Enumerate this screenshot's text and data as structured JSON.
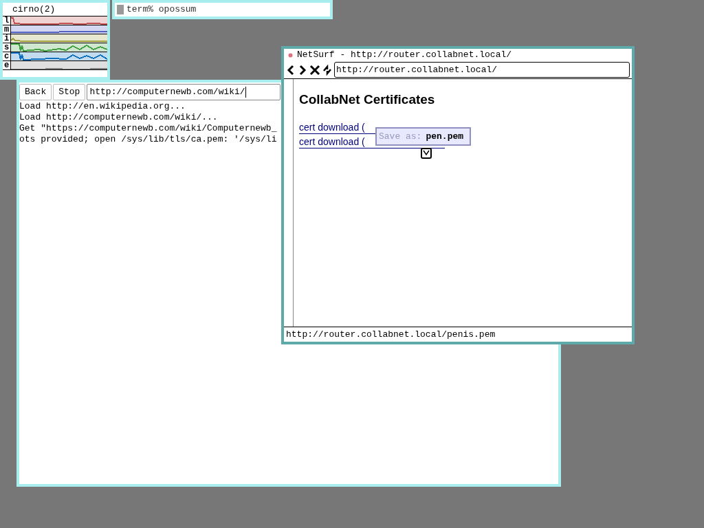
{
  "stats": {
    "title": "cirno(2)",
    "graphs": [
      {
        "label": "l",
        "color": "#c05050"
      },
      {
        "label": "m",
        "color": "#5060c0"
      },
      {
        "label": "i",
        "color": "#a0a040"
      },
      {
        "label": "s",
        "color": "#40a040"
      },
      {
        "label": "c",
        "color": "#1070c0"
      },
      {
        "label": "e",
        "color": "#808080"
      }
    ]
  },
  "terminal": {
    "line": "term% opossum"
  },
  "browser": {
    "buttons": [
      "Back",
      "Stop"
    ],
    "url": "http://computernewb.com/wiki/",
    "log": [
      "Load http://en.wikipedia.org...",
      "Load http://computernewb.com/wiki/...",
      "Get \"https://computernewb.com/wiki/Computernewb_",
      "ots provided; open /sys/lib/tls/ca.pem: '/sys/li"
    ]
  },
  "netsurf": {
    "title": "NetSurf - http://router.collabnet.local/",
    "url": "http://router.collabnet.local/",
    "heading": "CollabNet Certificates",
    "links": [
      "cert download (",
      "cert download ("
    ],
    "save_dialog": {
      "label": "Save as:",
      "value": "pen.pem"
    },
    "status": "http://router.collabnet.local/penis.pem"
  }
}
